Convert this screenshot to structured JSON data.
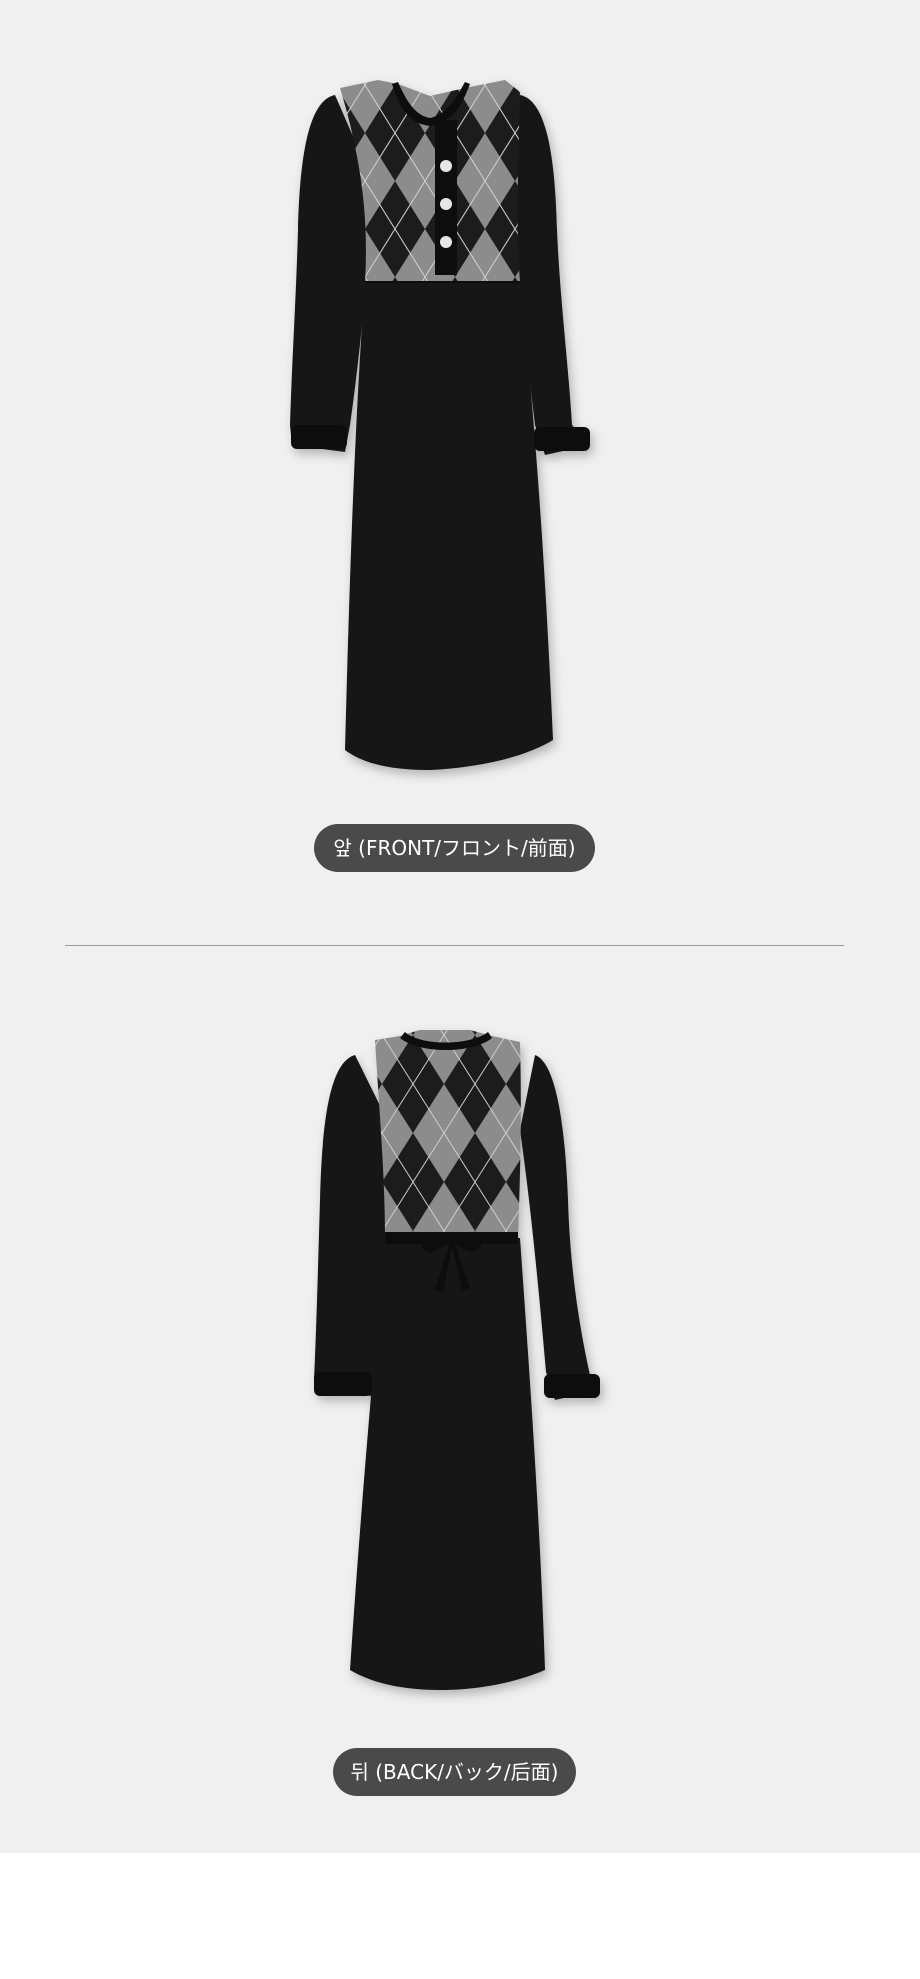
{
  "views": {
    "front": {
      "caption": "앞 (FRONT/フロント/前面)"
    },
    "back": {
      "caption": "뒤 (BACK/バック/后面)"
    }
  },
  "colors": {
    "background": "#f0f0f0",
    "dress": "#151515",
    "argyle_light": "#8c8c8c",
    "caption_bg": "#4a4a4a",
    "caption_text": "#ffffff"
  }
}
